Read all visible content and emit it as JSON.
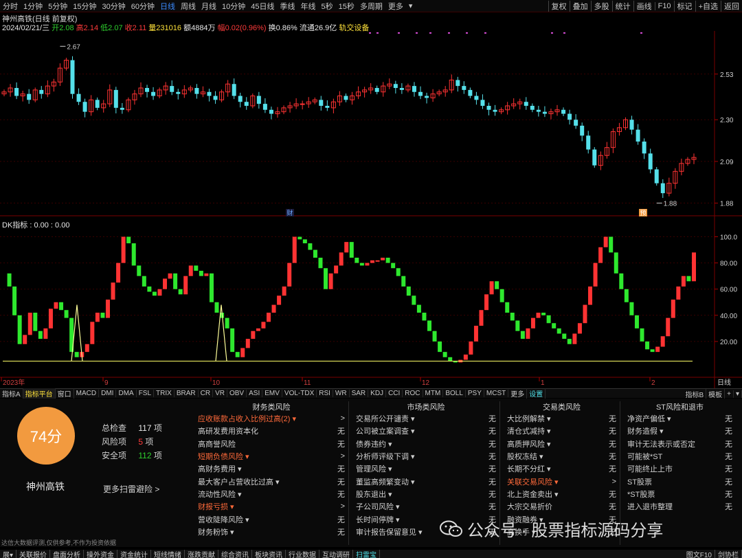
{
  "topbar": {
    "left_tabs": [
      "分时",
      "1分钟",
      "5分钟",
      "15分钟",
      "30分钟",
      "60分钟",
      "日线",
      "周线",
      "月线",
      "10分钟",
      "45日线",
      "季线",
      "年线",
      "5秒",
      "15秒",
      "多周期",
      "更多"
    ],
    "active_tab": "日线",
    "more_suffix": "▾",
    "right_tabs": [
      "复权",
      "叠加",
      "多股",
      "统计",
      "画线",
      "F10",
      "标记",
      "+自选",
      "返回"
    ]
  },
  "quote": {
    "title": "神州高铁(日线 前复权)",
    "date": "2024/02/21/三",
    "open_label": "开",
    "open": "2.08",
    "high_label": "高",
    "high": "2.14",
    "low_label": "低",
    "low": "2.07",
    "close_label": "收",
    "close": "2.11",
    "volume_label": "量",
    "volume": "231016",
    "amount_label": "额",
    "amount": "4884万",
    "change_label": "幅",
    "change": "0.02(0.96%)",
    "turnover_label": "换",
    "turnover": "0.86%",
    "float_label": "流通",
    "float": "26.9亿",
    "sector": "轨交设备"
  },
  "price_axis": [
    "2.53",
    "2.30",
    "2.09",
    "1.88"
  ],
  "price_marks": {
    "high": "2.67",
    "low": "1.88"
  },
  "event_tags": {
    "cai": "财",
    "yu": "预"
  },
  "indicator": {
    "name": "DK指标",
    "values": ": 0.00 : 0.00"
  },
  "ind_axis": [
    "100.0",
    "80.00",
    "60.00",
    "40.00",
    "20.00"
  ],
  "date_axis": [
    "2023年",
    "9",
    "10",
    "11",
    "12",
    "1",
    "2",
    "日线"
  ],
  "colors": {
    "up": "#ff3333",
    "down": "#2ee82e",
    "candle_down": "#55e0ea",
    "threshold": "#ffff66"
  },
  "chart_data": {
    "type": "candlestick",
    "main": {
      "price_range": [
        1.83,
        2.73
      ],
      "closes": [
        2.44,
        2.46,
        2.42,
        2.43,
        2.4,
        2.45,
        2.43,
        2.47,
        2.49,
        2.56,
        2.6,
        2.43,
        2.39,
        2.34,
        2.4,
        2.36,
        2.38,
        2.45,
        2.36,
        2.35,
        2.4,
        2.43,
        2.46,
        2.44,
        2.42,
        2.45,
        2.47,
        2.44,
        2.43,
        2.45,
        2.46,
        2.43,
        2.44,
        2.42,
        2.4,
        2.44,
        2.48,
        2.42,
        2.39,
        2.37,
        2.42,
        2.38,
        2.35,
        2.33,
        2.34,
        2.36,
        2.37,
        2.38,
        2.38,
        2.39,
        2.4,
        2.37,
        2.36,
        2.39,
        2.42,
        2.4,
        2.42,
        2.44,
        2.45,
        2.46,
        2.44,
        2.47,
        2.48,
        2.46,
        2.45,
        2.47,
        2.44,
        2.42,
        2.41,
        2.43,
        2.44,
        2.45,
        2.5,
        2.47,
        2.45,
        2.42,
        2.4,
        2.37,
        2.35,
        2.34,
        2.35,
        2.37,
        2.38,
        2.39,
        2.37,
        2.35,
        2.34,
        2.33,
        2.34,
        2.35,
        2.33,
        2.3,
        2.27,
        2.22,
        2.15,
        2.07,
        2.12,
        2.16,
        2.24,
        2.26,
        2.3,
        2.25,
        2.19,
        2.13,
        2.05,
        1.98,
        1.93,
        1.98,
        2.04,
        2.08,
        2.1,
        2.11
      ],
      "high_mark": 2.67,
      "low_mark": 1.88
    },
    "indicator": {
      "range": [
        0,
        105
      ],
      "values": [
        72,
        62,
        40,
        18,
        25,
        42,
        28,
        22,
        30,
        45,
        50,
        44,
        38,
        12,
        8,
        12,
        18,
        35,
        42,
        38,
        52,
        65,
        80,
        100,
        95,
        78,
        70,
        62,
        58,
        55,
        60,
        68,
        72,
        60,
        56,
        70,
        78,
        74,
        70,
        72,
        50,
        42,
        38,
        30,
        12,
        8,
        15,
        22,
        28,
        30,
        35,
        42,
        48,
        55,
        62,
        80,
        100,
        98,
        95,
        90,
        84,
        76,
        60,
        72,
        78,
        88,
        96,
        84,
        80,
        78,
        80,
        82,
        82,
        84,
        80,
        76,
        70,
        62,
        55,
        48,
        42,
        36,
        28,
        20,
        12,
        8,
        5,
        4,
        6,
        10,
        20,
        32,
        44,
        56,
        66,
        60,
        50,
        42,
        36,
        28,
        22,
        30,
        38,
        42,
        40,
        34,
        30,
        26,
        22,
        18,
        26,
        34,
        48,
        62,
        80,
        92,
        100,
        88,
        72,
        60,
        50,
        40,
        30,
        20,
        14,
        12,
        16,
        24,
        38,
        52,
        62,
        70,
        66,
        88
      ]
    },
    "threshold": 5
  },
  "indicator_tabs": [
    "指标A",
    "指标平台",
    "窗口",
    "MACD",
    "DMI",
    "DMA",
    "FSL",
    "TRIX",
    "BRAR",
    "CR",
    "VR",
    "OBV",
    "ASI",
    "EMV",
    "VOL-TDX",
    "RSI",
    "WR",
    "SAR",
    "KDJ",
    "CCI",
    "ROC",
    "MTM",
    "BOLL",
    "PSY",
    "MCST",
    "更多",
    "设置"
  ],
  "indicator_active": "指标平台",
  "indicator_right": [
    "指标B",
    "模板",
    "+",
    "▾"
  ],
  "scan": {
    "score": "74分",
    "stock": "神州高铁",
    "total_label": "总检查",
    "total_value": "117",
    "total_unit": "项",
    "risk_label": "风险项",
    "risk_value": "5",
    "risk_unit": "项",
    "safe_label": "安全项",
    "safe_value": "112",
    "safe_unit": "项",
    "more": "更多扫雷避险 >"
  },
  "risk_columns": [
    {
      "title": "财务类风险",
      "rows": [
        {
          "name": "应收账款占收入比例过高(2) ▾",
          "val": ">",
          "risk": true
        },
        {
          "name": "高研发费用资本化",
          "val": "无",
          "risk": false
        },
        {
          "name": "高商誉风险",
          "val": "无",
          "risk": false
        },
        {
          "name": "短期负债风险 ▾",
          "val": ">",
          "risk": true
        },
        {
          "name": "高财务费用 ▾",
          "val": "无",
          "risk": false
        },
        {
          "name": "最大客户占营收比过高 ▾",
          "val": "无",
          "risk": false
        },
        {
          "name": "流动性风险 ▾",
          "val": "无",
          "risk": false
        },
        {
          "name": "财报亏损 ▾",
          "val": ">",
          "risk": true
        },
        {
          "name": "营收陡降风险 ▾",
          "val": "无",
          "risk": false
        },
        {
          "name": "财务粉饰 ▾",
          "val": "无",
          "risk": false
        }
      ]
    },
    {
      "title": "市场类风险",
      "rows": [
        {
          "name": "交易所公开谴责 ▾",
          "val": "无",
          "risk": false
        },
        {
          "name": "公司被立案调查 ▾",
          "val": "无",
          "risk": false
        },
        {
          "name": "债券违约 ▾",
          "val": "无",
          "risk": false
        },
        {
          "name": "分析师评级下调 ▾",
          "val": "无",
          "risk": false
        },
        {
          "name": "管理风险 ▾",
          "val": "无",
          "risk": false
        },
        {
          "name": "董监高频繁变动 ▾",
          "val": "无",
          "risk": false
        },
        {
          "name": "股东退出 ▾",
          "val": "无",
          "risk": false
        },
        {
          "name": "子公司风险 ▾",
          "val": "无",
          "risk": false
        },
        {
          "name": "长时间停牌 ▾",
          "val": "无",
          "risk": false
        },
        {
          "name": "审计报告保留意见 ▾",
          "val": "无",
          "risk": false
        }
      ]
    },
    {
      "title": "交易类风险",
      "rows": [
        {
          "name": "大比例解禁 ▾",
          "val": "无",
          "risk": false
        },
        {
          "name": "清仓式减持 ▾",
          "val": "无",
          "risk": false
        },
        {
          "name": "高质押风险 ▾",
          "val": "无",
          "risk": false
        },
        {
          "name": "股权冻结 ▾",
          "val": "无",
          "risk": false
        },
        {
          "name": "长期不分红 ▾",
          "val": "无",
          "risk": false
        },
        {
          "name": "关联交易风险 ▾",
          "val": ">",
          "risk": true
        },
        {
          "name": "北上资金卖出 ▾",
          "val": "无",
          "risk": false
        },
        {
          "name": "大宗交易折价",
          "val": "无",
          "risk": false
        },
        {
          "name": "融资融券 ▾",
          "val": "无",
          "risk": false
        },
        {
          "name": "高换手 ▾",
          "val": "无",
          "risk": false
        }
      ]
    },
    {
      "title": "ST风险和退市",
      "rows": [
        {
          "name": "净资产偏低 ▾",
          "val": "无",
          "risk": false
        },
        {
          "name": "财务造假 ▾",
          "val": "无",
          "risk": false
        },
        {
          "name": "审计无法表示或否定",
          "val": "无",
          "risk": false
        },
        {
          "name": "可能被*ST",
          "val": "无",
          "risk": false
        },
        {
          "name": "可能终止上市",
          "val": "无",
          "risk": false
        },
        {
          "name": "ST股票",
          "val": "无",
          "risk": false
        },
        {
          "name": "*ST股票",
          "val": "无",
          "risk": false
        },
        {
          "name": "进入退市整理",
          "val": "无",
          "risk": false
        }
      ]
    }
  ],
  "disclaimer": "达信大数据评测,仅供参考,不作为投资依据",
  "statusbar": {
    "tabs": [
      "展▾",
      "关联报价",
      "盘面分析",
      "操外资金",
      "资金统计",
      "短线情绪",
      "涨跌贡献",
      "综合资讯",
      "板块资讯",
      "行业数据",
      "互动调研",
      "扫雷宝"
    ],
    "active": "扫雷宝",
    "right": [
      "图文F10",
      "剑协栏"
    ]
  },
  "watermark": "公众号 · 股票指标源码分享"
}
